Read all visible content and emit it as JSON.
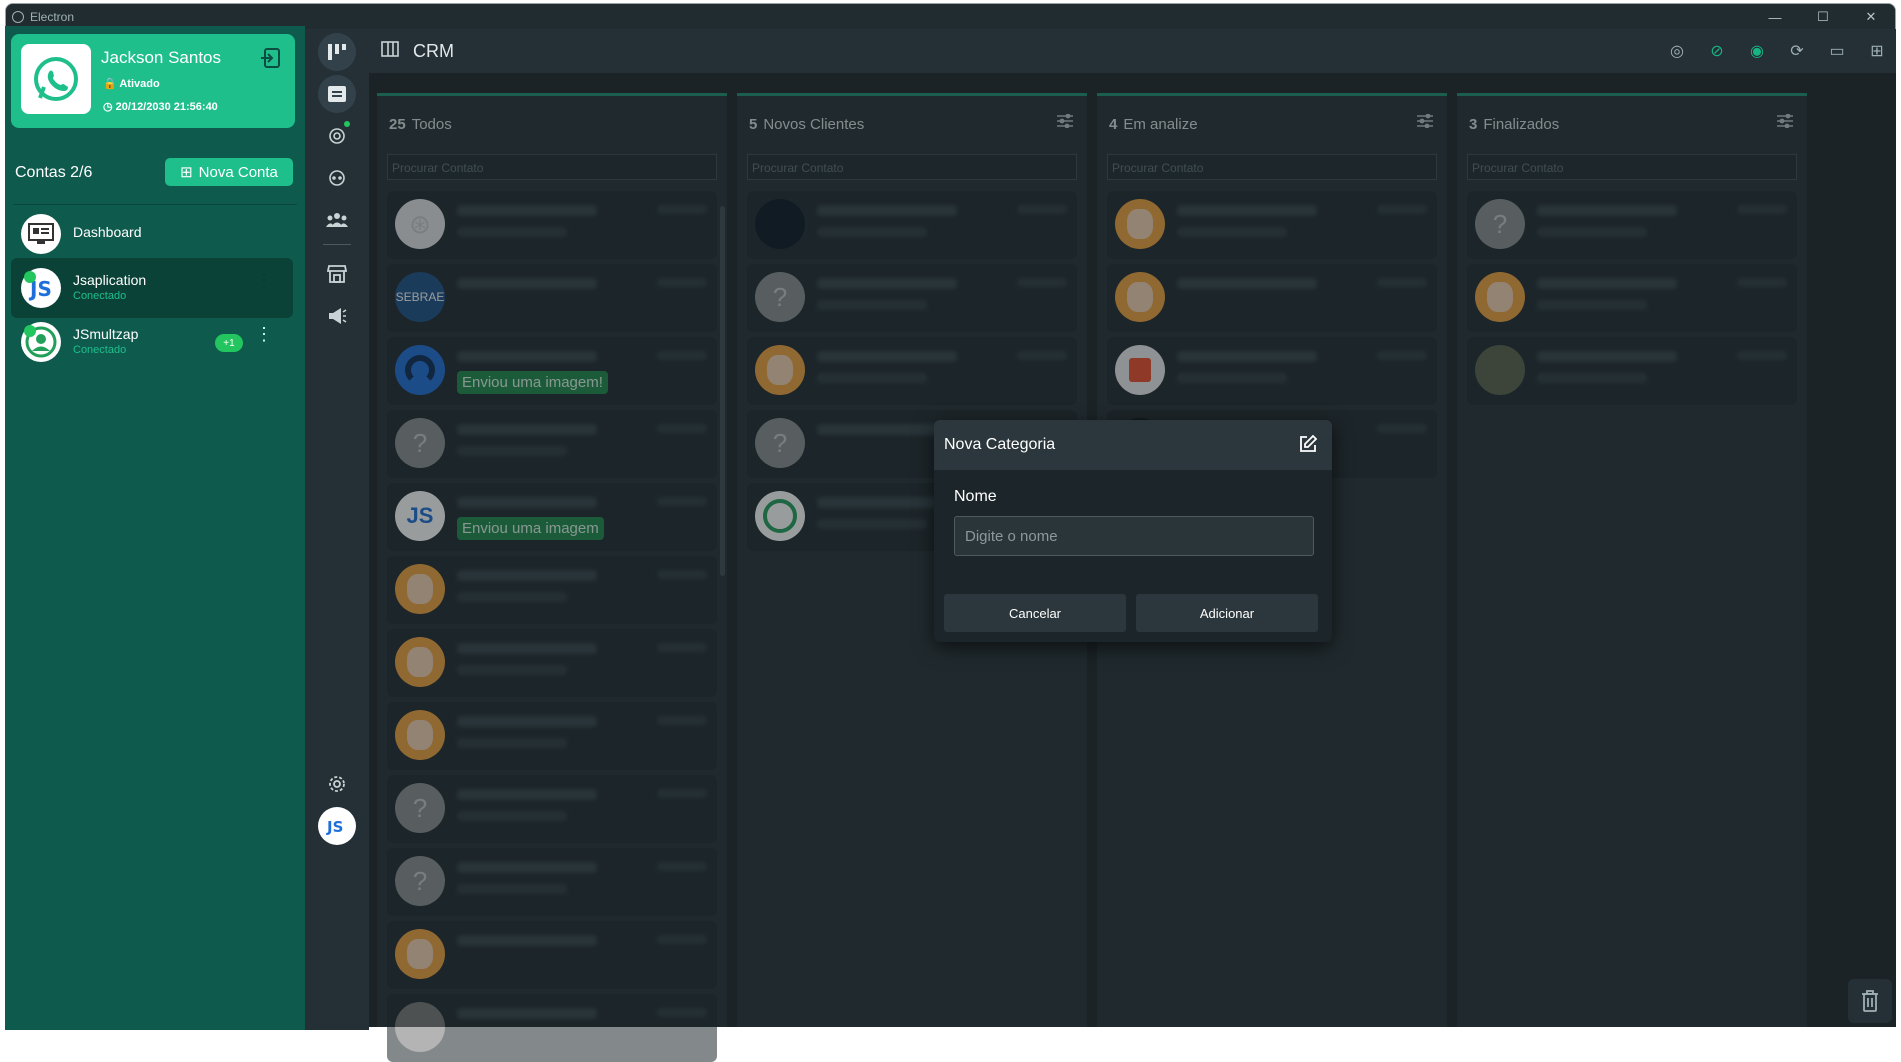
{
  "titlebar": {
    "title": "Electron",
    "min": "—",
    "max": "☐",
    "close": "✕"
  },
  "profile": {
    "name": "Jackson Santos",
    "status": "Ativado",
    "date": "20/12/2030 21:56:40"
  },
  "accounts_header": {
    "label": "Contas 2/6",
    "new_account": "Nova Conta"
  },
  "accounts": [
    {
      "name": "Dashboard",
      "sub": ""
    },
    {
      "name": "Jsaplication",
      "sub": "Conectado"
    },
    {
      "name": "JSmultzap",
      "sub": "Conectado",
      "badge": "+1"
    }
  ],
  "header": {
    "title": "CRM"
  },
  "columns": [
    {
      "count": "25",
      "name": "Todos",
      "search_placeholder": "Procurar Contato"
    },
    {
      "count": "5",
      "name": "Novos Clientes",
      "search_placeholder": "Procurar Contato"
    },
    {
      "count": "4",
      "name": "Em analize",
      "search_placeholder": "Procurar Contato"
    },
    {
      "count": "3",
      "name": "Finalizados",
      "search_placeholder": "Procurar Contato"
    }
  ],
  "badges": {
    "img1": "Enviou uma imagem!",
    "img2": "Enviou uma imagem"
  },
  "modal": {
    "title": "Nova Categoria",
    "field_label": "Nome",
    "placeholder": "Digite o nome",
    "cancel": "Cancelar",
    "add": "Adicionar"
  },
  "colors": {
    "accent": "#1fbf8c",
    "sidebar": "#0e5a4d",
    "bg": "#1b2326"
  }
}
